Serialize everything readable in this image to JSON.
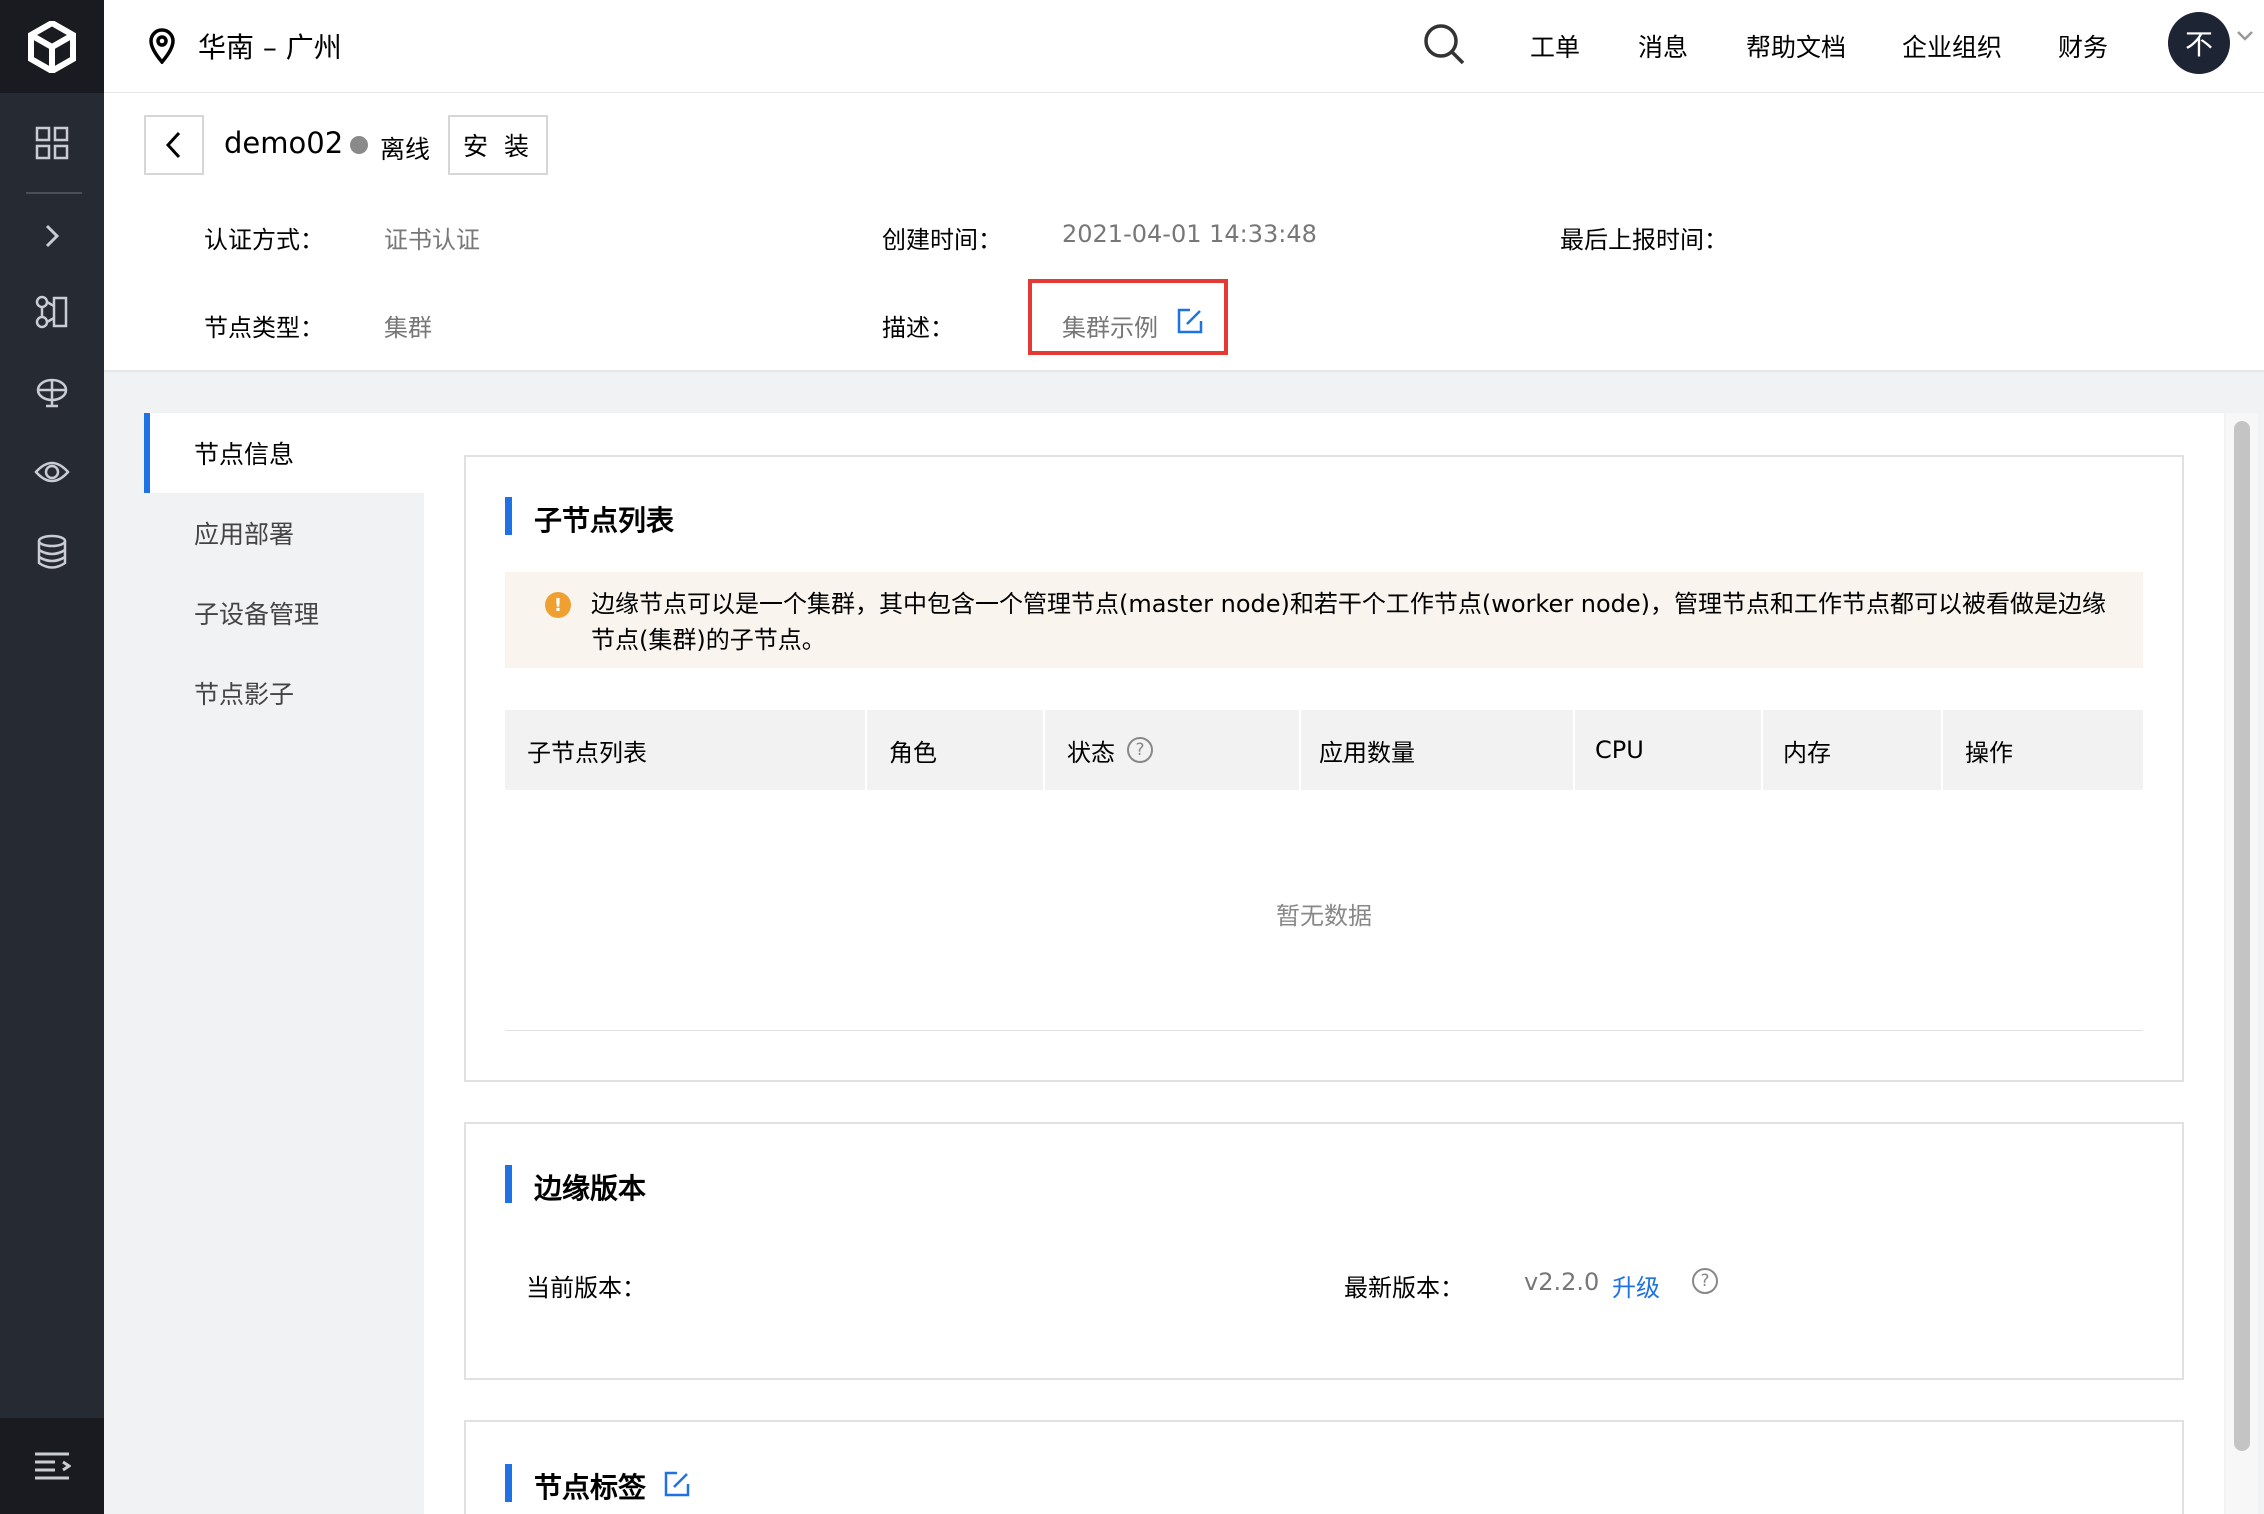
{
  "topbar": {
    "region": "华南 – 广州",
    "links": [
      "工单",
      "消息",
      "帮助文档",
      "企业组织",
      "财务"
    ],
    "avatar": "不"
  },
  "header": {
    "node_name": "demo02",
    "status": "离线",
    "install_label": "安 装",
    "auth_label": "认证方式：",
    "auth_value": "证书认证",
    "created_label": "创建时间：",
    "created_value": "2021-04-01 14:33:48",
    "last_report_label": "最后上报时间：",
    "node_type_label": "节点类型：",
    "node_type_value": "集群",
    "desc_label": "描述：",
    "desc_value": "集群示例"
  },
  "sidetabs": [
    "节点信息",
    "应用部署",
    "子设备管理",
    "节点影子"
  ],
  "subnodes": {
    "title": "子节点列表",
    "notice": "边缘节点可以是一个集群，其中包含一个管理节点(master node)和若干个工作节点(worker node)，管理节点和工作节点都可以被看做是边缘节点(集群)的子节点。",
    "columns": [
      "子节点列表",
      "角色",
      "状态",
      "应用数量",
      "CPU",
      "内存",
      "操作"
    ],
    "empty": "暂无数据"
  },
  "edge_version": {
    "title": "边缘版本",
    "current_label": "当前版本：",
    "latest_label": "最新版本：",
    "latest_value": "v2.2.0",
    "upgrade": "升级"
  },
  "node_tags": {
    "title": "节点标签"
  },
  "colors": {
    "accent": "#1e72e4",
    "nav_bg": "#262a33",
    "highlight": "#e53935",
    "warning": "#f0a030"
  }
}
